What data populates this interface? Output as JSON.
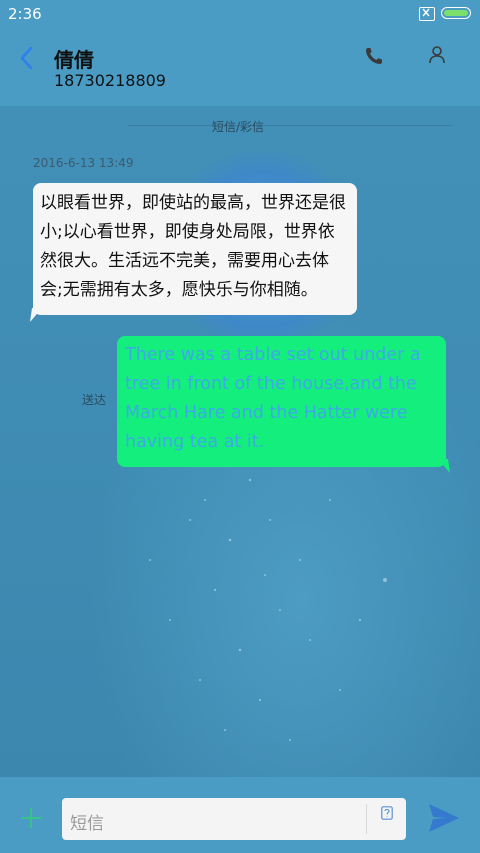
{
  "status": {
    "time": "2:36"
  },
  "header": {
    "contact_name": "倩倩",
    "phone_number": "18730218809"
  },
  "thread": {
    "channel_label": "短信/彩信",
    "timestamp": "2016-6-13 13:49",
    "incoming": {
      "text": "以眼看世界，即使站的最高，世界还是很小;以心看世界，即使身处局限，世界依然很大。生活远不完美，需要用心去体会;无需拥有太多，愿快乐与你相随。"
    },
    "outgoing": {
      "text": "There was a table set out under a tree in front of the house,and the March Hare and the Hatter were having tea at it.",
      "status": "送达"
    }
  },
  "composer": {
    "placeholder": "短信"
  },
  "icons": [
    "back-icon",
    "phone-icon",
    "contact-icon",
    "plus-icon",
    "attach-icon",
    "send-icon"
  ],
  "colors": {
    "bar": "#4a9cc5",
    "incoming_bubble": "#f6f6f6",
    "outgoing_bubble": "#14ee7c",
    "outgoing_text": "#3ea8e8",
    "accent": "#2f7ff0"
  }
}
